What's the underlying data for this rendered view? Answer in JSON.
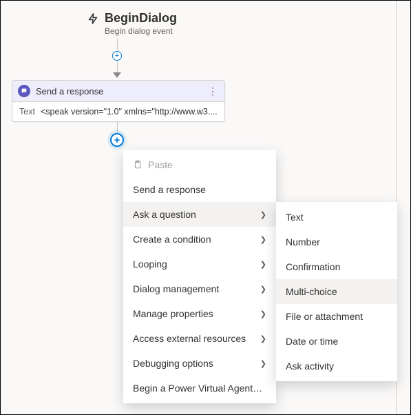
{
  "trigger": {
    "title": "BeginDialog",
    "subtitle": "Begin dialog event"
  },
  "node": {
    "title": "Send a response",
    "field_label": "Text",
    "field_value": "<speak version=\"1.0\" xmlns=\"http://www.w3...."
  },
  "menu": {
    "paste": "Paste",
    "items": [
      {
        "label": "Send a response",
        "submenu": false,
        "hover": false
      },
      {
        "label": "Ask a question",
        "submenu": true,
        "hover": true
      },
      {
        "label": "Create a condition",
        "submenu": true,
        "hover": false
      },
      {
        "label": "Looping",
        "submenu": true,
        "hover": false
      },
      {
        "label": "Dialog management",
        "submenu": true,
        "hover": false
      },
      {
        "label": "Manage properties",
        "submenu": true,
        "hover": false
      },
      {
        "label": "Access external resources",
        "submenu": true,
        "hover": false
      },
      {
        "label": "Debugging options",
        "submenu": true,
        "hover": false
      },
      {
        "label": "Begin a Power Virtual Agents topic",
        "submenu": false,
        "hover": false
      }
    ]
  },
  "submenu": {
    "items": [
      {
        "label": "Text",
        "hover": false
      },
      {
        "label": "Number",
        "hover": false
      },
      {
        "label": "Confirmation",
        "hover": false
      },
      {
        "label": "Multi-choice",
        "hover": true
      },
      {
        "label": "File or attachment",
        "hover": false
      },
      {
        "label": "Date or time",
        "hover": false
      },
      {
        "label": "Ask activity",
        "hover": false
      }
    ]
  }
}
